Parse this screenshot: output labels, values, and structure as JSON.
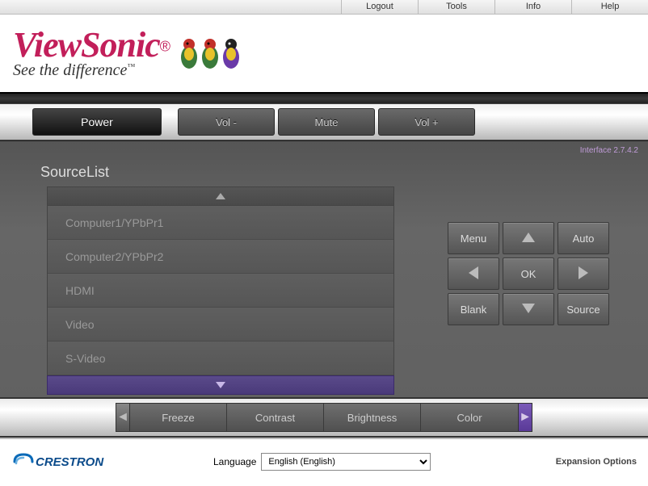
{
  "topnav": {
    "logout": "Logout",
    "tools": "Tools",
    "info": "Info",
    "help": "Help"
  },
  "logo": {
    "brand": "ViewSonic",
    "tagline": "See the difference"
  },
  "controlbar": {
    "power": "Power",
    "voldown": "Vol -",
    "mute": "Mute",
    "volup": "Vol +"
  },
  "interface_version": "Interface 2.7.4.2",
  "sourcelist": {
    "title": "SourceList",
    "items": [
      "Computer1/YPbPr1",
      "Computer2/YPbPr2",
      "HDMI",
      "Video",
      "S-Video"
    ]
  },
  "keypad": {
    "menu": "Menu",
    "auto": "Auto",
    "ok": "OK",
    "blank": "Blank",
    "source": "Source"
  },
  "tabs": {
    "items": [
      "Freeze",
      "Contrast",
      "Brightness",
      "Color"
    ]
  },
  "footer": {
    "crestron": "CRESTRON",
    "language_label": "Language",
    "language_selected": "English (English)",
    "expansion": "Expansion Options"
  }
}
